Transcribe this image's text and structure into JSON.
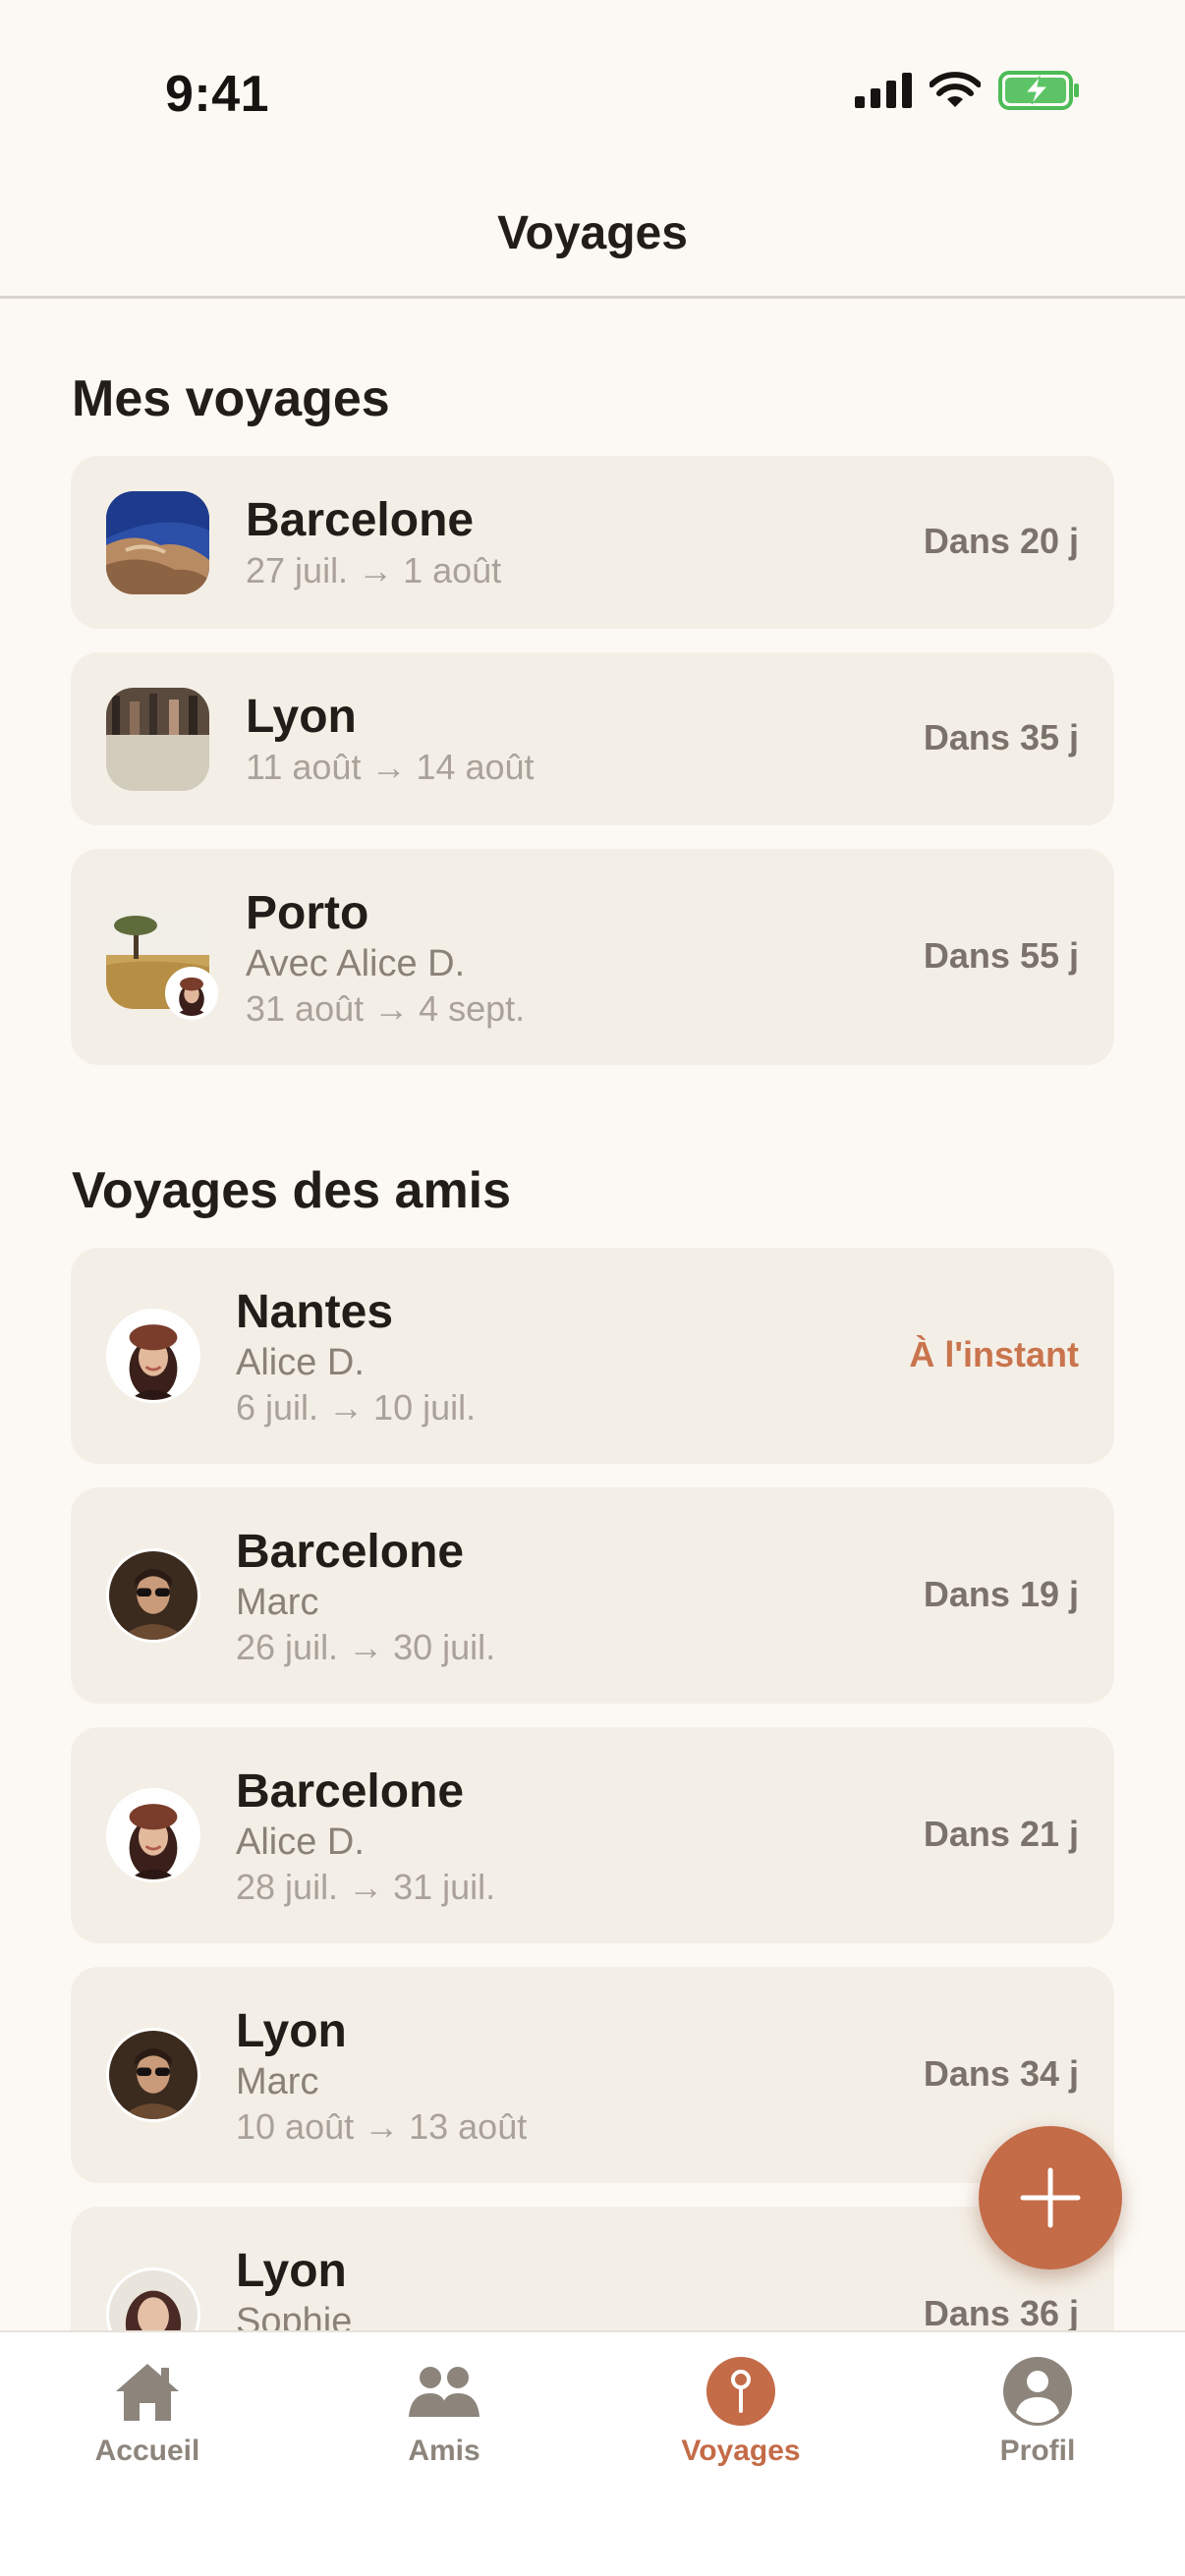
{
  "status": {
    "time": "9:41"
  },
  "nav": {
    "title": "Voyages"
  },
  "my_trips": {
    "heading": "Mes voyages",
    "items": [
      {
        "city": "Barcelone",
        "dates": "27 juil. → 1 août",
        "countdown": "Dans 20 j"
      },
      {
        "city": "Lyon",
        "dates": "11 août → 14 août",
        "countdown": "Dans 35 j"
      },
      {
        "city": "Porto",
        "companion": "Avec Alice D.",
        "dates": "31 août → 4 sept.",
        "countdown": "Dans 55 j"
      }
    ]
  },
  "friends_trips": {
    "heading": "Voyages des amis",
    "items": [
      {
        "city": "Nantes",
        "friend": "Alice D.",
        "dates": "6 juil. → 10 juil.",
        "countdown": "À l'instant"
      },
      {
        "city": "Barcelone",
        "friend": "Marc",
        "dates": "26 juil. → 30 juil.",
        "countdown": "Dans 19 j"
      },
      {
        "city": "Barcelone",
        "friend": "Alice D.",
        "dates": "28 juil. → 31 juil.",
        "countdown": "Dans 21 j"
      },
      {
        "city": "Lyon",
        "friend": "Marc",
        "dates": "10 août → 13 août",
        "countdown": "Dans 34 j"
      },
      {
        "city": "Lyon",
        "friend": "Sophie",
        "countdown": "Dans 36 j"
      }
    ]
  },
  "tabs": [
    {
      "label": "Accueil",
      "icon": "house-icon"
    },
    {
      "label": "Amis",
      "icon": "people-icon"
    },
    {
      "label": "Voyages",
      "icon": "pin-icon",
      "active": true
    },
    {
      "label": "Profil",
      "icon": "person-icon"
    }
  ],
  "colors": {
    "accent": "#c46b48",
    "card": "#f4efe6",
    "background": "#fcf9f4"
  }
}
